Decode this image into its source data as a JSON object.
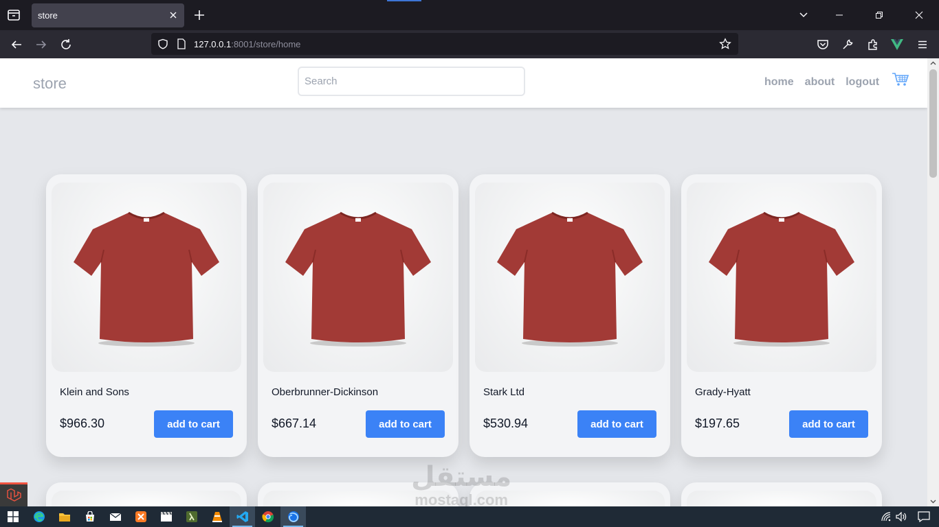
{
  "browser": {
    "tab_title": "store",
    "url_host": "127.0.0.1",
    "url_rest": ":8001/store/home"
  },
  "site": {
    "brand": "store",
    "search_placeholder": "Search",
    "nav": [
      "home",
      "about",
      "logout"
    ]
  },
  "products": [
    {
      "name": "Klein and Sons",
      "price": "$966.30",
      "button": "add to cart"
    },
    {
      "name": "Oberbrunner-Dickinson",
      "price": "$667.14",
      "button": "add to cart"
    },
    {
      "name": "Stark Ltd",
      "price": "$530.94",
      "button": "add to cart"
    },
    {
      "name": "Grady-Hyatt",
      "price": "$197.65",
      "button": "add to cart"
    }
  ],
  "colors": {
    "accent": "#3b82f6",
    "page_bg": "#e5e7eb",
    "muted_text": "#9ca3af",
    "shirt": "#a23a36"
  },
  "watermark": {
    "arabic": "مستقل",
    "latin": "mostaql.com"
  },
  "icons": {
    "cart": "cart-icon",
    "product_image": "red-tshirt-image"
  }
}
